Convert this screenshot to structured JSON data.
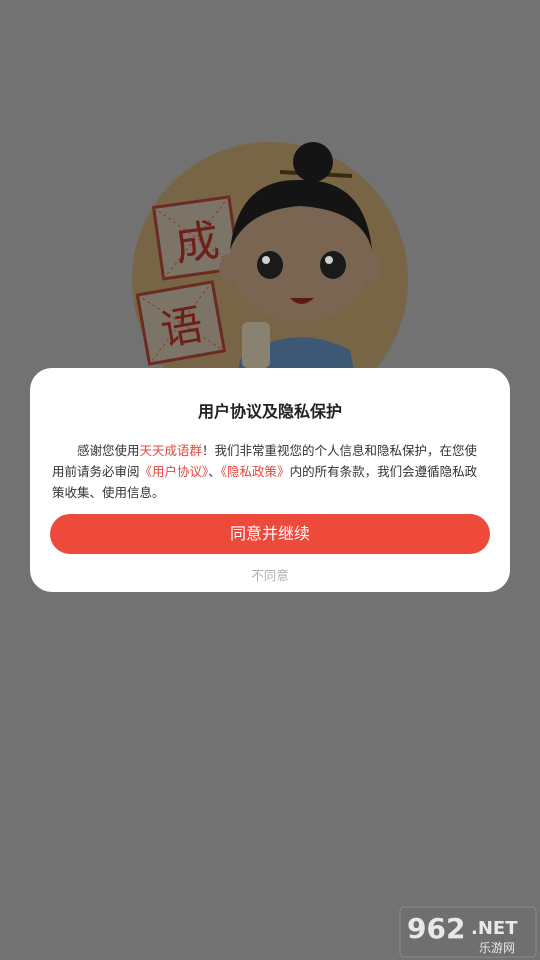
{
  "mascot": {
    "tile_1": "成",
    "tile_2": "语"
  },
  "dialog": {
    "title": "用户协议及隐私保护",
    "body": {
      "p1": "感谢您使用",
      "app_name": "天天成语群",
      "p2": "！我们非常重视您的个人信息和隐私保护，在您使用前请务必审阅",
      "user_agreement": "《用户协议》",
      "sep": "、",
      "privacy_policy": "《隐私政策》",
      "p3": "内的所有条款，我们会遵循隐私政策收集、使用信息。"
    },
    "agree_label": "同意并继续",
    "disagree_label": "不同意"
  },
  "watermark": {
    "number": "962",
    "suffix": ".NET",
    "caption": "乐游网"
  },
  "colors": {
    "accent": "#ee4a3c",
    "link": "#e8483b",
    "overlay": "#727272"
  }
}
